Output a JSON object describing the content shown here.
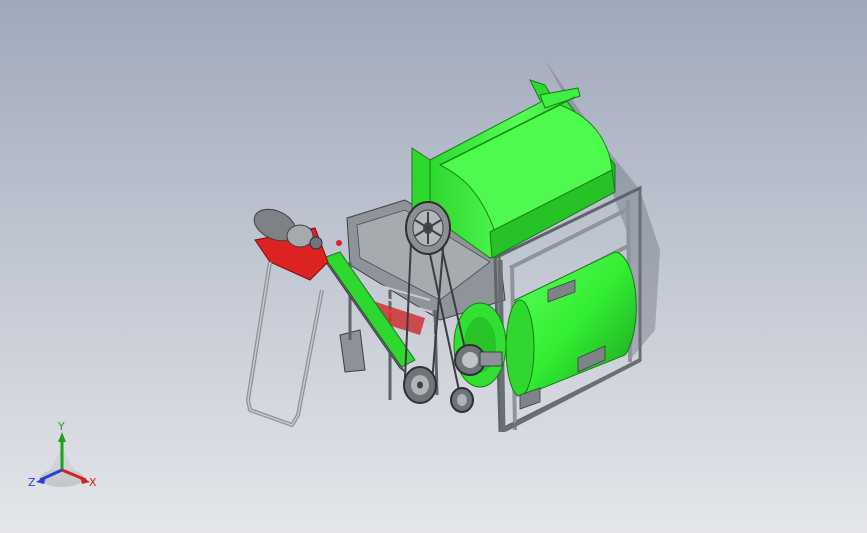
{
  "viewport": {
    "background_top": "#a0a9bb",
    "background_bottom": "#e4e6ea"
  },
  "model": {
    "body_color": "#33ee33",
    "body_dark": "#1fb51f",
    "frame_color": "#9ea3a8",
    "frame_dark": "#5f6468",
    "accent_red": "#dd2222",
    "wheel_color": "#6f7478"
  },
  "triad": {
    "y_label": "Y",
    "x_label": "X",
    "z_label": "Z",
    "y_color": "#1fa01f",
    "x_color": "#d22222",
    "z_color": "#2a3fd8"
  }
}
